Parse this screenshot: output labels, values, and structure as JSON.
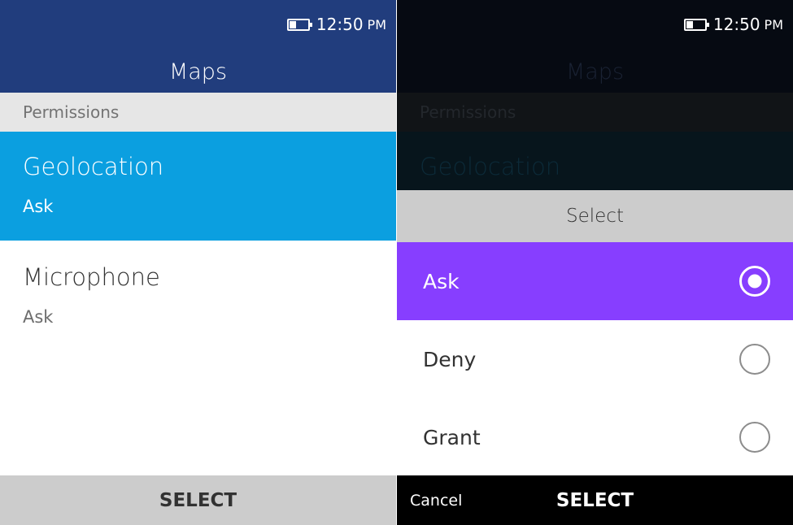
{
  "colors": {
    "left_header_bg": "#213d7d",
    "focus_blue": "#0b9fe0",
    "focus_purple": "#873eff",
    "softkey_light": "#cccccc",
    "softkey_dark": "#000000"
  },
  "left": {
    "status": {
      "time": "12:50",
      "ampm": "PM"
    },
    "header": "Maps",
    "section": "Permissions",
    "items": [
      {
        "title": "Geolocation",
        "value": "Ask"
      },
      {
        "title": "Microphone",
        "value": "Ask"
      }
    ],
    "softkeys": {
      "center": "SELECT"
    }
  },
  "right": {
    "status": {
      "time": "12:50",
      "ampm": "PM"
    },
    "header": "Maps",
    "section": "Permissions",
    "bg_item": "Geolocation",
    "dialog": {
      "title": "Select",
      "options": [
        {
          "label": "Ask",
          "selected": true
        },
        {
          "label": "Deny",
          "selected": false
        },
        {
          "label": "Grant",
          "selected": false
        }
      ]
    },
    "softkeys": {
      "left": "Cancel",
      "center": "SELECT"
    }
  }
}
